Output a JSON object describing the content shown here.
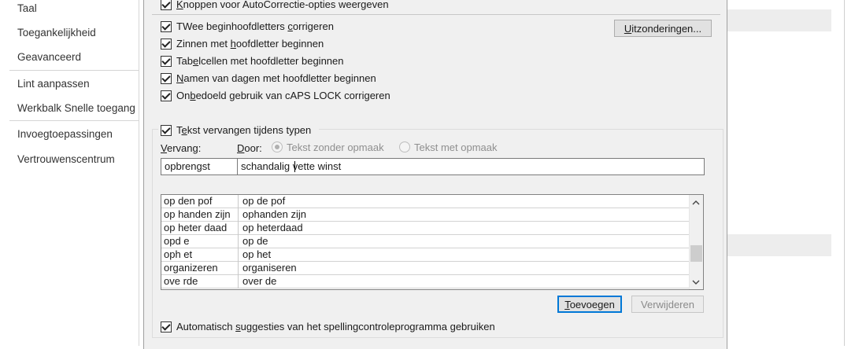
{
  "nav": {
    "items": [
      {
        "label": "Taal"
      },
      {
        "label": "Toegankelijkheid"
      },
      {
        "label": "Geavanceerd"
      },
      {
        "label": "Lint aanpassen"
      },
      {
        "label": "Werkbalk Snelle toegang"
      },
      {
        "label": "Invoegtoepassingen"
      },
      {
        "label": "Vertrouwenscentrum"
      }
    ]
  },
  "dialog": {
    "show_buttons": {
      "pre": "",
      "u": "K",
      "post": "noppen voor AutoCorrectie-opties weergeven"
    },
    "options": [
      {
        "pre": "TWee beginhoofdletters ",
        "u": "c",
        "post": "orrigeren"
      },
      {
        "pre": "Zinnen met ",
        "u": "h",
        "post": "oofdletter beginnen"
      },
      {
        "pre": "Tab",
        "u": "e",
        "post": "lcellen met hoofdletter beginnen"
      },
      {
        "pre": "",
        "u": "N",
        "post": "amen van dagen met hoofdletter beginnen"
      },
      {
        "pre": "On",
        "u": "b",
        "post": "edoeld gebruik van cAPS LOCK corrigeren"
      }
    ],
    "exceptions_button": {
      "pre": "",
      "u": "U",
      "post": "itzonderingen..."
    },
    "replace_group": {
      "pre": "T",
      "u": "e",
      "post": "kst vervangen tijdens typen"
    },
    "replace_label": {
      "pre": "",
      "u": "V",
      "post": "ervang:"
    },
    "with_label": {
      "pre": "",
      "u": "D",
      "post": "oor:"
    },
    "radio_plain": "Tekst zonder opmaak",
    "radio_formatted": "Tekst met opmaak",
    "replace_value": "opbrengst",
    "with_value": "schandalig vette winst",
    "list_rows": [
      {
        "replace": "op den pof",
        "with": "op de pof"
      },
      {
        "replace": "op handen zijn",
        "with": "ophanden zijn"
      },
      {
        "replace": "op heter daad",
        "with": "op heterdaad"
      },
      {
        "replace": "opd e",
        "with": "op de"
      },
      {
        "replace": "oph et",
        "with": "op het"
      },
      {
        "replace": "organizeren",
        "with": "organiseren"
      },
      {
        "replace": "ove rde",
        "with": "over de"
      }
    ],
    "add_button": {
      "pre": "",
      "u": "T",
      "post": "oevoegen"
    },
    "delete_button": "Verwijderen",
    "suggestions": {
      "pre": "Automatisch ",
      "u": "s",
      "post": "uggesties van het spellingcontroleprogramma gebruiken"
    }
  },
  "icons": {
    "scroll_up": "chevron-up-icon",
    "scroll_down": "chevron-down-icon"
  }
}
